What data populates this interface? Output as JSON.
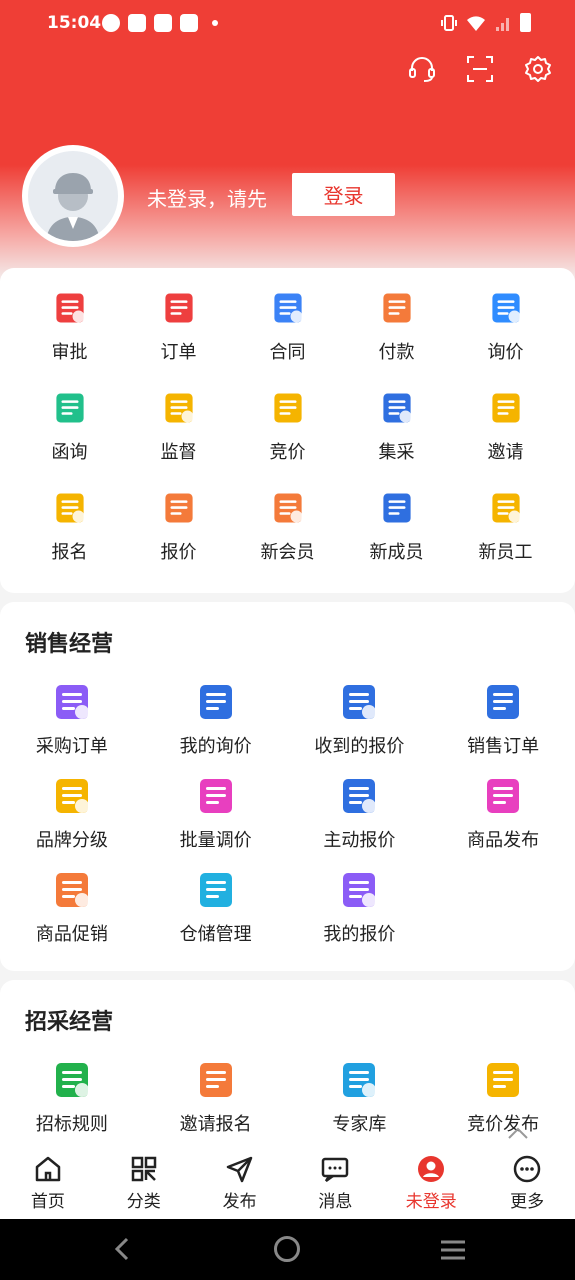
{
  "status": {
    "time": "15:04"
  },
  "profile": {
    "prompt": "未登录，请先",
    "login_button": "登录"
  },
  "services": [
    {
      "label": "审批",
      "icon": "approval-icon",
      "color": "#ee3f3f"
    },
    {
      "label": "订单",
      "icon": "order-icon",
      "color": "#ee3f3f"
    },
    {
      "label": "合同",
      "icon": "contract-icon",
      "color": "#3b82f6"
    },
    {
      "label": "付款",
      "icon": "wallet-icon",
      "color": "#f47a3a"
    },
    {
      "label": "询价",
      "icon": "inquiry-icon",
      "color": "#2f8cff"
    },
    {
      "label": "函询",
      "icon": "letter-icon",
      "color": "#21c08b"
    },
    {
      "label": "监督",
      "icon": "police-cap-icon",
      "color": "#f5b400"
    },
    {
      "label": "竞价",
      "icon": "auction-icon",
      "color": "#f5b400"
    },
    {
      "label": "集采",
      "icon": "group-buy-icon",
      "color": "#2f6fe0"
    },
    {
      "label": "邀请",
      "icon": "invitation-icon",
      "color": "#f5b400"
    },
    {
      "label": "报名",
      "icon": "signup-icon",
      "color": "#f5b400"
    },
    {
      "label": "报价",
      "icon": "quote-icon",
      "color": "#f47a3a"
    },
    {
      "label": "新会员",
      "icon": "new-member-icon",
      "color": "#f47a3a"
    },
    {
      "label": "新成员",
      "icon": "new-staff-icon",
      "color": "#2f6fe0"
    },
    {
      "label": "新员工",
      "icon": "employee-card-icon",
      "color": "#f5b400"
    }
  ],
  "sales": {
    "title": "销售经营",
    "items": [
      {
        "label": "采购订单",
        "icon": "cart-icon",
        "color": "#8b5cf6"
      },
      {
        "label": "我的询价",
        "icon": "inquiry-bubble-icon",
        "color": "#2f6fe0"
      },
      {
        "label": "收到的报价",
        "icon": "monitor-price-icon",
        "color": "#2f6fe0"
      },
      {
        "label": "销售订单",
        "icon": "clipboard-icon",
        "color": "#2f6fe0"
      },
      {
        "label": "品牌分级",
        "icon": "tag-icon",
        "color": "#f5b400"
      },
      {
        "label": "批量调价",
        "icon": "batch-price-icon",
        "color": "#e83fbf"
      },
      {
        "label": "主动报价",
        "icon": "active-quote-icon",
        "color": "#2f6fe0"
      },
      {
        "label": "商品发布",
        "icon": "shopping-bag-icon",
        "color": "#e83fbf"
      },
      {
        "label": "商品促销",
        "icon": "store-promo-icon",
        "color": "#f47a3a"
      },
      {
        "label": "仓储管理",
        "icon": "warehouse-icon",
        "color": "#21b0e0"
      },
      {
        "label": "我的报价",
        "icon": "user-price-icon",
        "color": "#8b5cf6"
      }
    ]
  },
  "procurement": {
    "title": "招采经营",
    "items": [
      {
        "label": "招标规则",
        "icon": "rule-book-icon",
        "color": "#22b14c"
      },
      {
        "label": "邀请报名",
        "icon": "invite-signup-icon",
        "color": "#f47a3a"
      },
      {
        "label": "专家库",
        "icon": "graduation-cap-icon",
        "color": "#21a0e0"
      },
      {
        "label": "竞价发布",
        "icon": "auction-publish-icon",
        "color": "#f5b400"
      }
    ]
  },
  "nav": [
    {
      "label": "首页",
      "icon": "home-icon"
    },
    {
      "label": "分类",
      "icon": "category-icon"
    },
    {
      "label": "发布",
      "icon": "send-icon"
    },
    {
      "label": "消息",
      "icon": "message-icon"
    },
    {
      "label": "未登录",
      "icon": "user-icon",
      "active": true
    },
    {
      "label": "更多",
      "icon": "more-icon"
    }
  ],
  "colors": {
    "brand": "#ef3e36",
    "active": "#e8362e"
  }
}
